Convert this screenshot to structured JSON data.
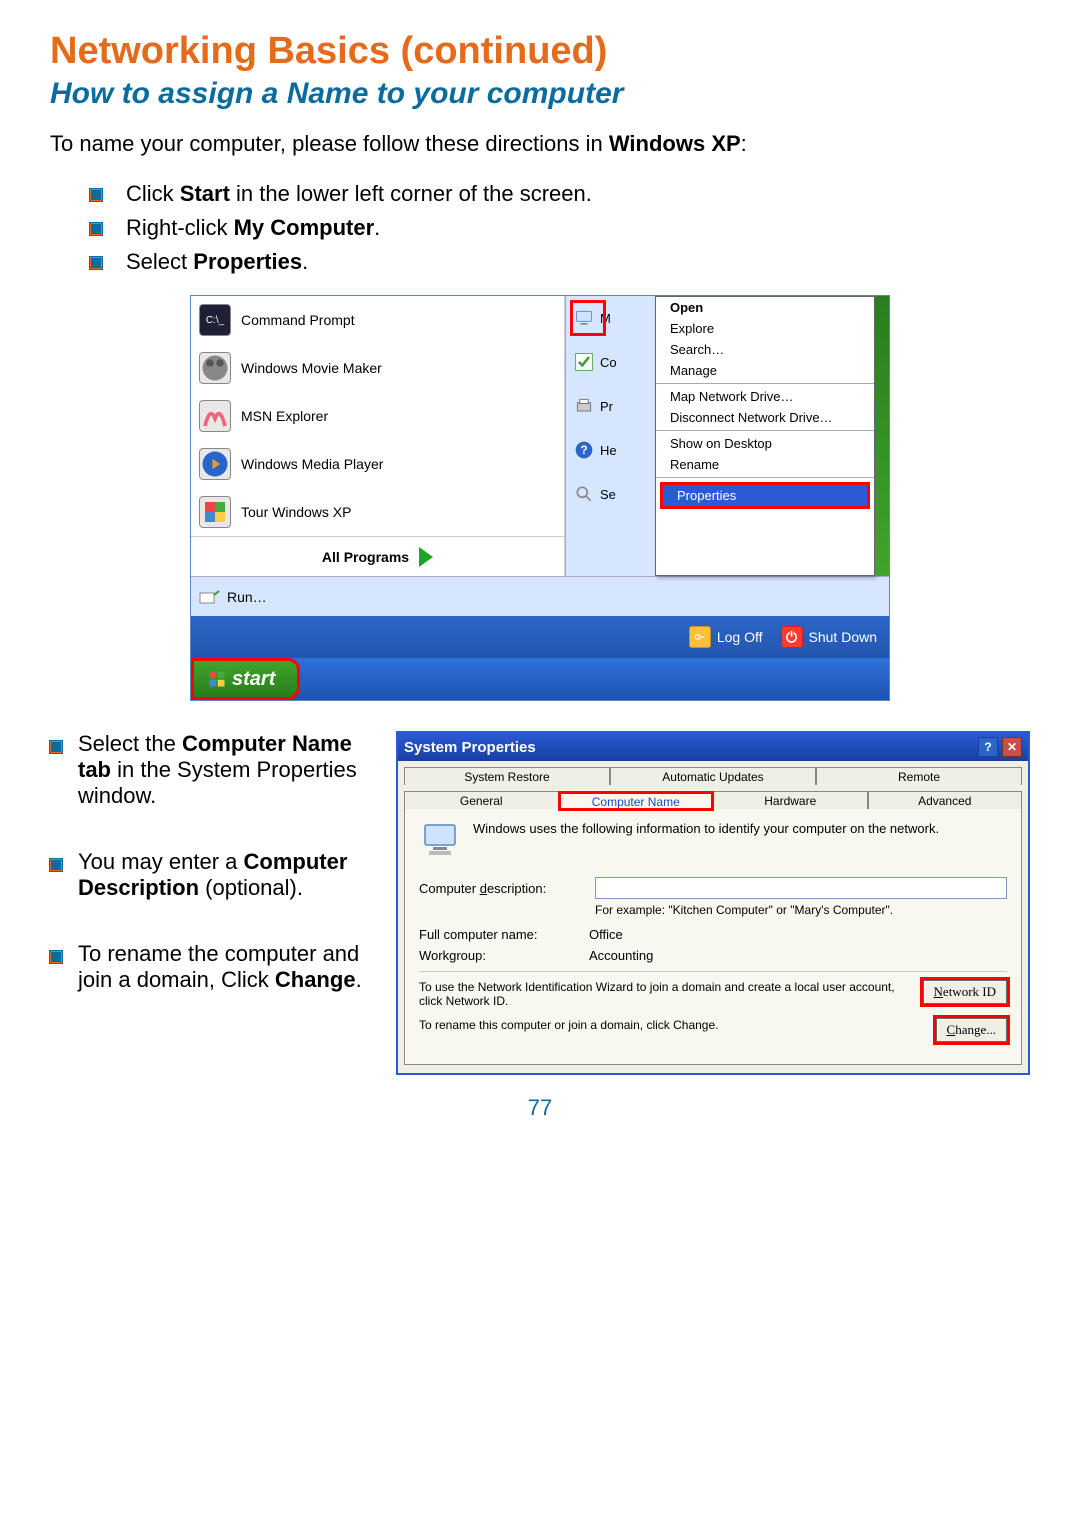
{
  "headings": {
    "title": "Networking Basics (continued)",
    "subtitle": "How to assign a Name to your computer"
  },
  "intro": {
    "pre": "To name your computer, please follow these directions in ",
    "bold": "Windows XP",
    "post": ":"
  },
  "top_bullets": {
    "b1_pre": "Click ",
    "b1_bold": "Start",
    "b1_post": " in the lower left corner of the screen.",
    "b2_pre": "Right-click ",
    "b2_bold": "My Computer",
    "b2_post": ".",
    "b3_pre": "Select  ",
    "b3_bold": "Properties",
    "b3_post": "."
  },
  "figure1": {
    "programs": {
      "p1": "Command Prompt",
      "p2": "Windows Movie Maker",
      "p3": "MSN Explorer",
      "p4": "Windows Media Player",
      "p5": "Tour Windows XP",
      "all": "All Programs"
    },
    "mid": {
      "mycomputer_short": "M",
      "cp_short": "Co",
      "pr_short": "Pr",
      "he_short": "He",
      "se_short": "Se",
      "run": "Run…"
    },
    "context": {
      "open": "Open",
      "explore": "Explore",
      "search": "Search…",
      "manage": "Manage",
      "mapdrive": "Map Network Drive…",
      "discdrive": "Disconnect Network Drive…",
      "showdesk": "Show on Desktop",
      "rename": "Rename",
      "properties": "Properties"
    },
    "statusbar": {
      "logoff": "Log Off",
      "shutdown": "Shut Down"
    },
    "start": "start",
    "cmd_icon_text": "C:\\_"
  },
  "lower_bullets": {
    "b1_pre": "Select the ",
    "b1_bold": "Computer Name tab",
    "b1_post": " in the System Properties window.",
    "b2_pre": "You may enter a ",
    "b2_bold": "Computer Description",
    "b2_post": " (optional).",
    "b3_pre": "To rename the computer and join a domain, Click ",
    "b3_bold": "Change",
    "b3_post": "."
  },
  "figure2": {
    "title": "System Properties",
    "tabs": {
      "sysrestore": "System Restore",
      "autoupdates": "Automatic Updates",
      "remote": "Remote",
      "general": "General",
      "compname": "Computer Name",
      "hardware": "Hardware",
      "advanced": "Advanced"
    },
    "desc": "Windows uses the following information to identify your computer on the network.",
    "labels": {
      "compdesc_prefix": "Computer ",
      "compdesc_ul": "d",
      "compdesc_suffix": "escription:",
      "hint": "For example: \"Kitchen Computer\" or \"Mary's Computer\".",
      "fullname_k": "Full computer name:",
      "fullname_v": "Office",
      "workgroup_k": "Workgroup:",
      "workgroup_v": "Accounting"
    },
    "netid_text": "To use the Network Identification Wizard to join a domain and create a local user account, click Network ID.",
    "netid_btn_ul": "N",
    "netid_btn_rest": "etwork ID",
    "change_text": "To rename this computer or join a domain, click Change.",
    "change_btn_ul": "C",
    "change_btn_rest": "hange..."
  },
  "page_number": "77"
}
